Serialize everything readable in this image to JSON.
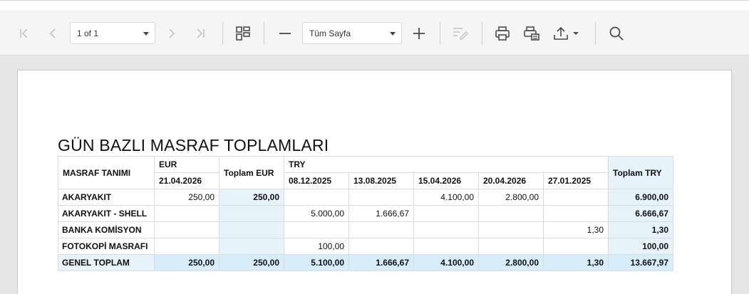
{
  "toolbar": {
    "page_selector": {
      "value": "1 of 1"
    },
    "zoom_selector": {
      "value": "Tüm Sayfa"
    },
    "icons": [
      "first-page-icon",
      "prev-page-icon",
      "next-page-icon",
      "last-page-icon",
      "multipage-icon",
      "zoom-out-icon",
      "zoom-in-icon",
      "edit-icon",
      "print-icon",
      "print-page-icon",
      "export-icon",
      "search-icon"
    ]
  },
  "report": {
    "title": "GÜN BAZLI MASRAF TOPLAMLARI",
    "headers": {
      "masraf_tanimi": "MASRAF TANIMI",
      "eur": "EUR",
      "eur_dates": [
        "21.04.2026"
      ],
      "toplam_eur": "Toplam EUR",
      "try": "TRY",
      "try_dates": [
        "08.12.2025",
        "13.08.2025",
        "15.04.2026",
        "20.04.2026",
        "27.01.2025"
      ],
      "toplam_try": "Toplam TRY"
    },
    "rows": [
      {
        "name": "AKARYAKIT",
        "eur": [
          "250,00"
        ],
        "toplam_eur": "250,00",
        "try": [
          "",
          "",
          "4.100,00",
          "2.800,00",
          ""
        ],
        "toplam_try": "6.900,00"
      },
      {
        "name": "AKARYAKIT - SHELL",
        "eur": [
          ""
        ],
        "toplam_eur": "",
        "try": [
          "5.000,00",
          "1.666,67",
          "",
          "",
          ""
        ],
        "toplam_try": "6.666,67"
      },
      {
        "name": "BANKA KOMİSYON",
        "eur": [
          ""
        ],
        "toplam_eur": "",
        "try": [
          "",
          "",
          "",
          "",
          "1,30"
        ],
        "toplam_try": "1,30"
      },
      {
        "name": "FOTOKOPİ MASRAFI",
        "eur": [
          ""
        ],
        "toplam_eur": "",
        "try": [
          "100,00",
          "",
          "",
          "",
          ""
        ],
        "toplam_try": "100,00"
      }
    ],
    "grand_total": {
      "name": "GENEL TOPLAM",
      "eur": [
        "250,00"
      ],
      "toplam_eur": "250,00",
      "try": [
        "5.100,00",
        "1.666,67",
        "4.100,00",
        "2.800,00",
        "1,30"
      ],
      "toplam_try": "13.667,97"
    }
  }
}
